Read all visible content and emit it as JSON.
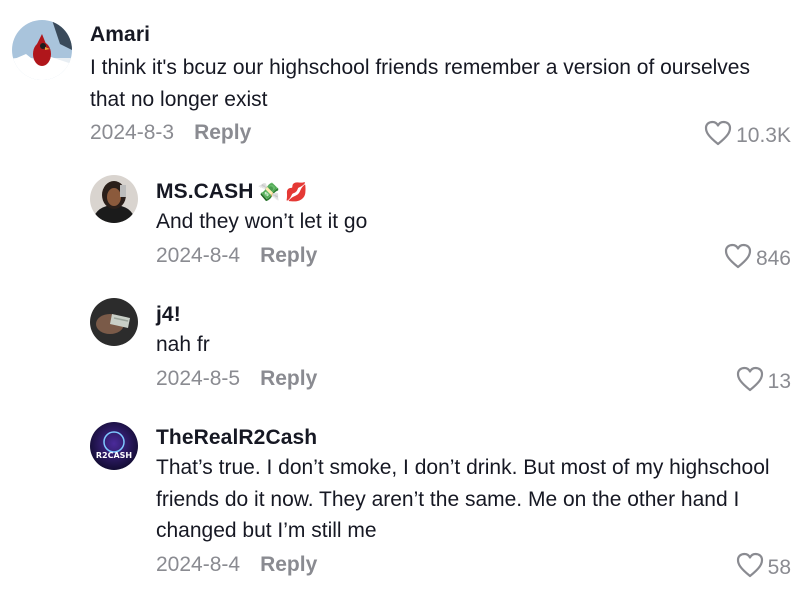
{
  "comments": [
    {
      "username": "Amari",
      "emoji": "",
      "text": "I think it's bcuz our highschool friends remember a version of ourselves that no longer exist",
      "date": "2024-8-3",
      "reply_label": "Reply",
      "likes": "10.3K",
      "avatar_icon": "cardinal-bird-avatar"
    },
    {
      "username": "MS.CASH",
      "emoji": "💸 💋",
      "text": "And they won’t let it go",
      "date": "2024-8-4",
      "reply_label": "Reply",
      "likes": "846",
      "avatar_icon": "person-avatar"
    },
    {
      "username": "j4!",
      "emoji": "",
      "text": "nah fr",
      "date": "2024-8-5",
      "reply_label": "Reply",
      "likes": "13",
      "avatar_icon": "hand-cash-avatar"
    },
    {
      "username": "TheRealR2Cash",
      "emoji": "",
      "text": "That’s true. I don’t smoke, I don’t drink. But most of my highschool friends do it now. They aren’t the same. Me on the other hand I changed but I’m still me",
      "date": "2024-8-4",
      "reply_label": "Reply",
      "likes": "58",
      "avatar_icon": "r2cash-logo-avatar",
      "avatar_text": "R2CASH"
    }
  ],
  "colors": {
    "text": "#161823",
    "muted": "#8a8b91",
    "background": "#ffffff"
  }
}
